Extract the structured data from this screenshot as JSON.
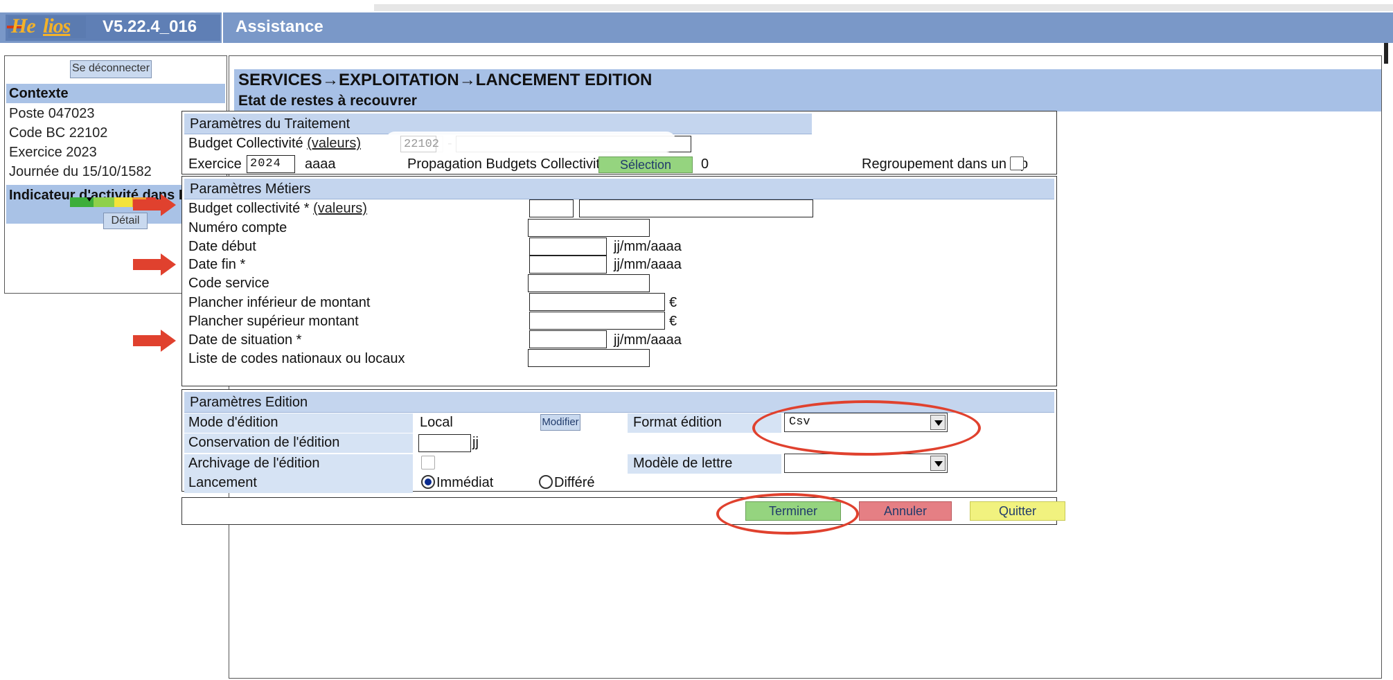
{
  "header": {
    "logo_text_he": "He",
    "logo_text_lios": "lios",
    "version": "V5.22.4_016",
    "menu_title": "Assistance"
  },
  "sidebar": {
    "logout_button": "Se déconnecter",
    "context_title": "Contexte",
    "poste": "Poste 047023",
    "code_bc": "Code BC 22102",
    "exercice": "Exercice 2023",
    "journee": "Journée du 15/10/1582",
    "activity_title": "Indicateur d'activité dans Hélios",
    "detail_button": "Détail",
    "meter_colors": [
      "#3cae3a",
      "#8ed04a",
      "#f4e33a",
      "#f39d2b",
      "#e23a2a"
    ]
  },
  "breadcrumb": "SERVICES→EXPLOITATION→LANCEMENT EDITION",
  "page_subtitle": "Etat de restes à recouvrer",
  "traitement": {
    "title": "Paramètres du Traitement",
    "budget_label": "Budget Collectivité ",
    "budget_link": "(valeurs)",
    "budget_code": "22102",
    "budget_sep": "-",
    "exercice_label": "Exercice",
    "exercice_value": "2024",
    "exercice_hint": "aaaa",
    "propagation_label": "Propagation Budgets Collectivités",
    "selection_button": "Sélection",
    "selection_count": "0",
    "zip_label": "Regroupement dans un zip"
  },
  "metiers": {
    "title": "Paramètres Métiers",
    "budget_label": "Budget collectivité * ",
    "budget_link": "(valeurs)",
    "numero_compte": "Numéro compte",
    "date_debut": "Date début",
    "date_fin": "Date fin *",
    "code_service": "Code service",
    "plancher_inf": "Plancher inférieur de montant",
    "plancher_sup": "Plancher supérieur montant",
    "date_situation": "Date de situation *",
    "liste_codes": "Liste de codes nationaux ou locaux",
    "date_hint": "jj/mm/aaaa",
    "euro": "€"
  },
  "edition": {
    "title": "Paramètres Edition",
    "mode_label": "Mode d'édition",
    "mode_value": "Local",
    "modifier_button": "Modifier",
    "format_label": "Format édition",
    "format_value": "Csv",
    "conservation_label": "Conservation de l'édition",
    "conservation_unit": "jj",
    "archivage_label": "Archivage de l'édition",
    "modele_label": "Modèle de lettre",
    "modele_value": "",
    "lancement_label": "Lancement",
    "immediat": "Immédiat",
    "differe": "Différé"
  },
  "actions": {
    "terminer": "Terminer",
    "annuler": "Annuler",
    "quitter": "Quitter"
  },
  "colors": {
    "header_bg": "#7a98c8",
    "section_bar": "#a7c0e6",
    "annotation_red": "#e0412e",
    "btn_green": "#95d47f",
    "btn_red": "#e57f84",
    "btn_yellow": "#f1f27f"
  }
}
